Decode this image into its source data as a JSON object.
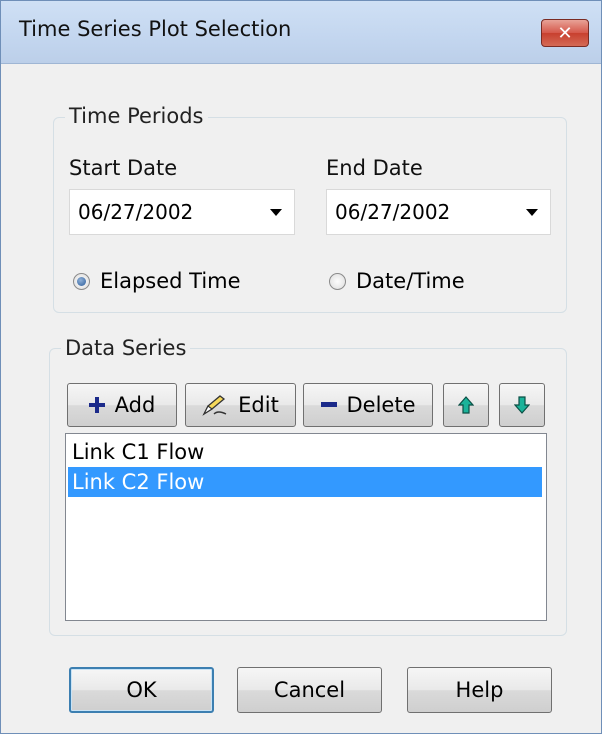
{
  "window": {
    "title": "Time Series Plot Selection",
    "close_label": "✕"
  },
  "time_periods": {
    "group_label": "Time Periods",
    "start_date_label": "Start Date",
    "start_date_value": "06/27/2002",
    "end_date_label": "End Date",
    "end_date_value": "06/27/2002",
    "time_format_options": [
      {
        "label": "Elapsed Time",
        "checked": true
      },
      {
        "label": "Date/Time",
        "checked": false
      }
    ]
  },
  "data_series": {
    "group_label": "Data Series",
    "toolbar": {
      "add_label": "Add",
      "edit_label": "Edit",
      "delete_label": "Delete"
    },
    "items": [
      {
        "label": "Link C1 Flow",
        "selected": false
      },
      {
        "label": "Link C2 Flow",
        "selected": true
      }
    ]
  },
  "footer": {
    "ok_label": "OK",
    "cancel_label": "Cancel",
    "help_label": "Help"
  },
  "colors": {
    "selection": "#3399ff",
    "close_button": "#c8402f",
    "add_icon": "#1b2a8a",
    "arrow_icon": "#1bb39a"
  }
}
